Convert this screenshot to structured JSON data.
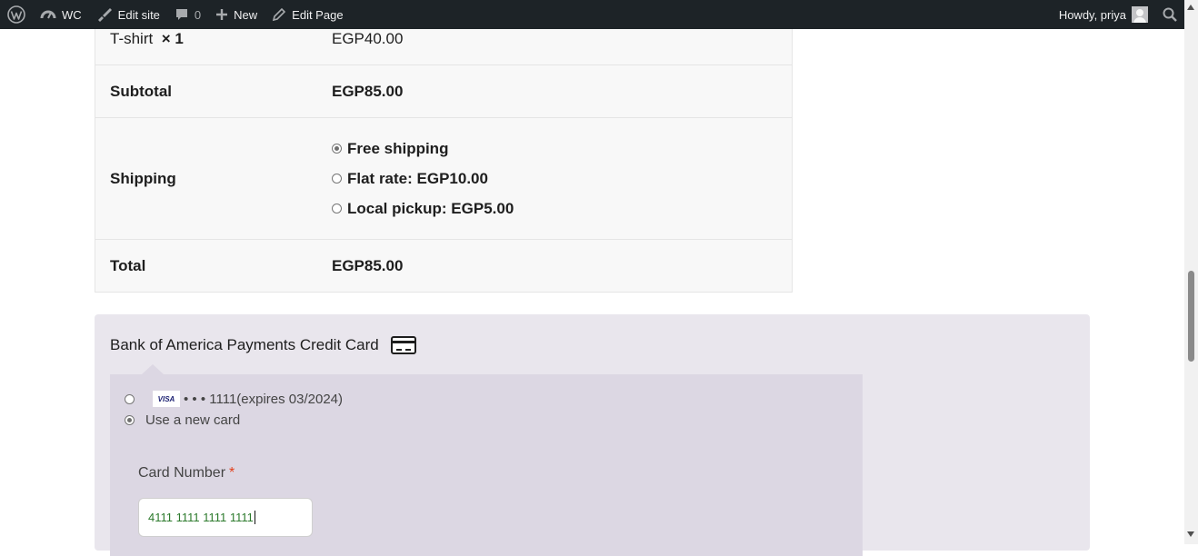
{
  "adminbar": {
    "site": "WC",
    "edit_site": "Edit site",
    "comments_count": "0",
    "new": "New",
    "edit_page": "Edit Page",
    "howdy": "Howdy, priya"
  },
  "order": {
    "item_name": "T-shirt",
    "item_qty": "× 1",
    "item_price": "EGP40.00",
    "subtotal_label": "Subtotal",
    "subtotal_value": "EGP85.00",
    "shipping_label": "Shipping",
    "shipping_options": [
      "Free shipping",
      "Flat rate: EGP10.00",
      "Local pickup: EGP5.00"
    ],
    "total_label": "Total",
    "total_value": "EGP85.00"
  },
  "payment": {
    "title": "Bank of America Payments Credit Card",
    "saved_card_brand": "VISA",
    "saved_card_text": "• • • 1111(expires 03/2024)",
    "new_card_label": "Use a new card",
    "card_number_label": "Card Number",
    "required_mark": "*",
    "card_number_value": "4111 1111 1111 1111"
  }
}
